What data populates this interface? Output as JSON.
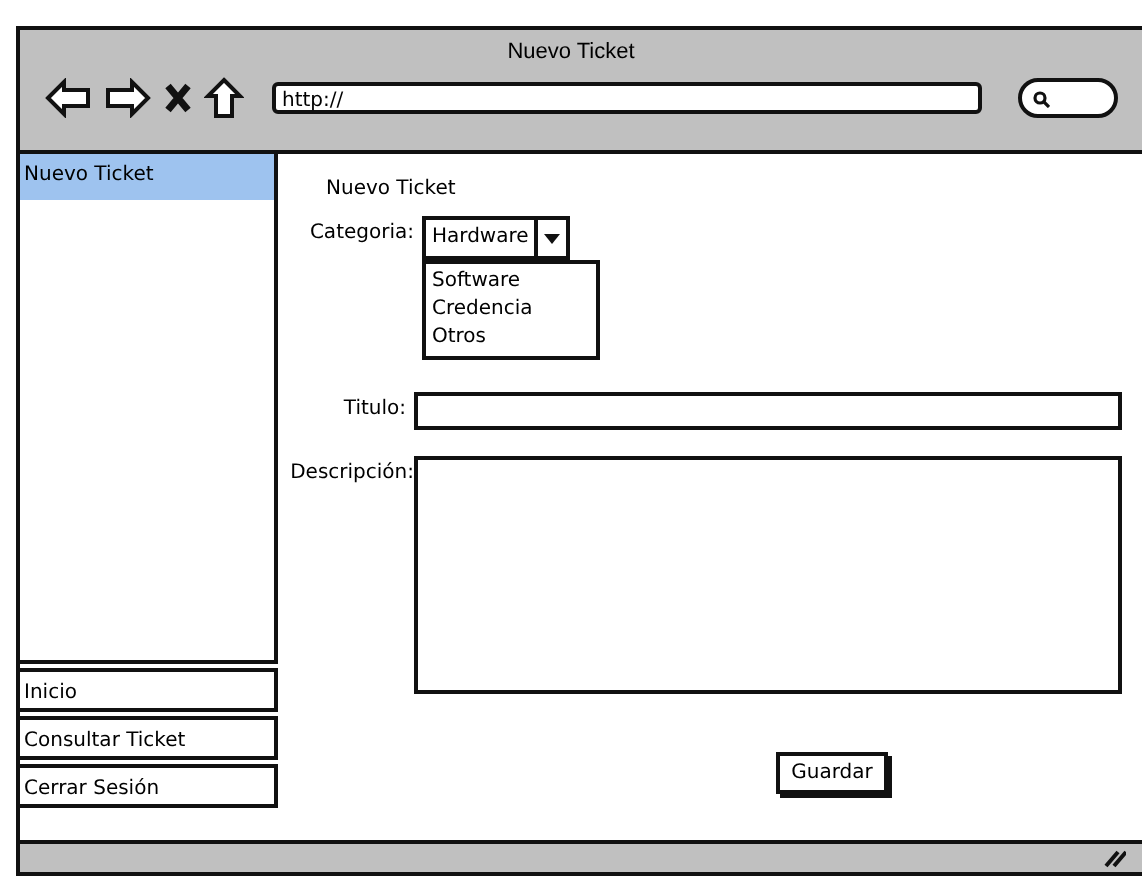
{
  "window": {
    "title": "Nuevo Ticket",
    "url": "http://"
  },
  "sidebar": {
    "top_items": [
      {
        "label": "Nuevo Ticket",
        "selected": true
      }
    ],
    "bottom_items": [
      {
        "label": "Inicio",
        "selected": false
      },
      {
        "label": "Consultar Ticket",
        "selected": false
      },
      {
        "label": "Cerrar Sesión",
        "selected": false
      }
    ]
  },
  "form": {
    "heading": "Nuevo Ticket",
    "category": {
      "label": "Categoria:",
      "value": "Hardware",
      "expanded": true,
      "options": [
        "Software",
        "Credencia",
        "Otros"
      ]
    },
    "title": {
      "label": "Titulo:"
    },
    "description": {
      "label": "Descripción:"
    },
    "save_button": "Guardar"
  }
}
